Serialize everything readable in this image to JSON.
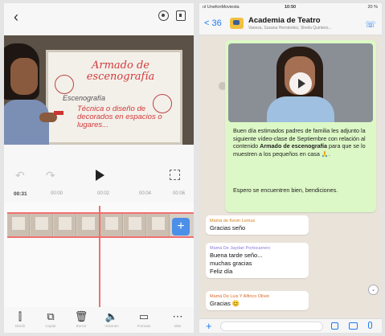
{
  "editor": {
    "video_board": {
      "title": "Armado de escenografía",
      "subtitle": "Escenografía",
      "body": "Técnica o diseño de decorados en espacios o lugares..."
    },
    "timeline": {
      "current_time": "00:31",
      "ticks": [
        "00:00",
        "00:02",
        "00:04",
        "00:06"
      ]
    },
    "tools": [
      {
        "icon": "split",
        "label": "Dividir"
      },
      {
        "icon": "copy",
        "label": "Copiar"
      },
      {
        "icon": "delete",
        "label": "Borrar"
      },
      {
        "icon": "volume",
        "label": "Volumen"
      },
      {
        "icon": "aspect",
        "label": "Formato"
      },
      {
        "icon": "more",
        "label": "Más"
      }
    ]
  },
  "whatsapp": {
    "status": {
      "carrier": "ııl UnefonMoviesta",
      "time": "10:50",
      "battery": "20 %"
    },
    "back_label": "< 36",
    "group_name": "Academia de Teatro",
    "members": "Vanesa, Susana Hernández, Sheila Quintero...",
    "video_message": {
      "text_pre": "Buen día estimados padres de familia les adjunto la siguiente vídeo-clase de Septiembre con relación al contenido ",
      "text_bold": "Armado de escenografía",
      "text_post": " para que se lo muestren a los pequeños en casa 🙏.",
      "text_2": "Espero se encuentren bien, bendiciones."
    },
    "messages": [
      {
        "sender": "Mamá de Kevin Lemus",
        "sender_color": "#d2801c",
        "body": "Gracias seño"
      },
      {
        "sender": "Mamá De Jaydan Portocarrero",
        "sender_color": "#8b7ad6",
        "body": "Buena tarde seño...\nmuchas gracias\nFeliz día"
      },
      {
        "sender": "Mamá De Luis Y Alfinco Olivet",
        "sender_color": "#d96a2a",
        "body": "Gracias 😊"
      }
    ],
    "accent": "#1f7cf0",
    "bubble_color": "#dcf8c6"
  }
}
